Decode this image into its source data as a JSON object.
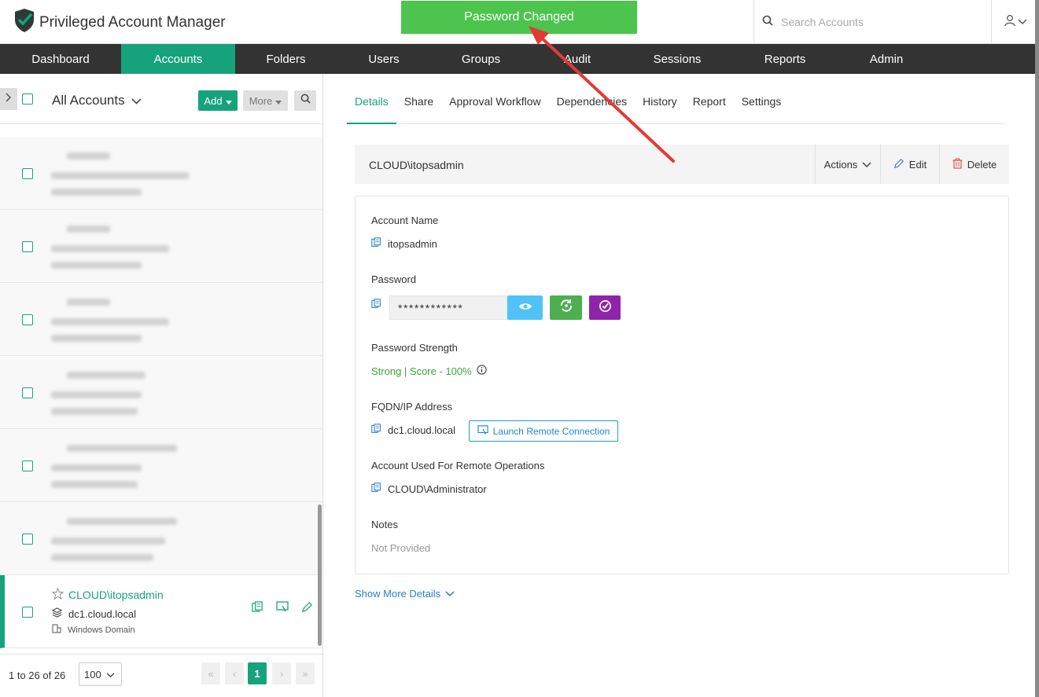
{
  "app": {
    "title": "Privileged Account Manager"
  },
  "toast": {
    "message": "Password Changed"
  },
  "search": {
    "placeholder": "Search Accounts"
  },
  "nav": {
    "items": [
      "Dashboard",
      "Accounts",
      "Folders",
      "Users",
      "Groups",
      "Audit",
      "Sessions",
      "Reports",
      "Admin"
    ],
    "active": "Accounts"
  },
  "left": {
    "heading": "All Accounts",
    "add_label": "Add",
    "more_label": "More",
    "selected": {
      "name": "CLOUD\\itopsadmin",
      "host": "dc1.cloud.local",
      "type": "Windows Domain"
    },
    "pager": {
      "range_text": "1 to 26 of 26",
      "page_size": "100",
      "current_page": "1",
      "first": "«",
      "prev": "‹",
      "next": "›",
      "last": "»"
    }
  },
  "tabs": [
    "Details",
    "Share",
    "Approval Workflow",
    "Dependencies",
    "History",
    "Report",
    "Settings"
  ],
  "account_bar": {
    "title": "CLOUD\\itopsadmin",
    "actions_label": "Actions",
    "edit_label": "Edit",
    "delete_label": "Delete"
  },
  "details": {
    "account_name_label": "Account Name",
    "account_name": "itopsadmin",
    "password_label": "Password",
    "password_masked": "************",
    "strength_label": "Password Strength",
    "strength_value": "Strong | Score - 100%",
    "fqdn_label": "FQDN/IP Address",
    "fqdn": "dc1.cloud.local",
    "launch_label": "Launch Remote Connection",
    "remote_ops_label": "Account Used For Remote Operations",
    "remote_ops": "CLOUD\\Administrator",
    "notes_label": "Notes",
    "notes": "Not Provided"
  },
  "show_more_label": "Show More Details",
  "colors": {
    "brand_green": "#16a37c",
    "toast_green": "#4dc44d",
    "nav_dark": "#333333",
    "eye_blue": "#4fc3f7",
    "rotate_green": "#4caf50",
    "verify_purple": "#8e24aa",
    "strength_green": "#3aa53a",
    "arrow_red": "#e53935"
  }
}
